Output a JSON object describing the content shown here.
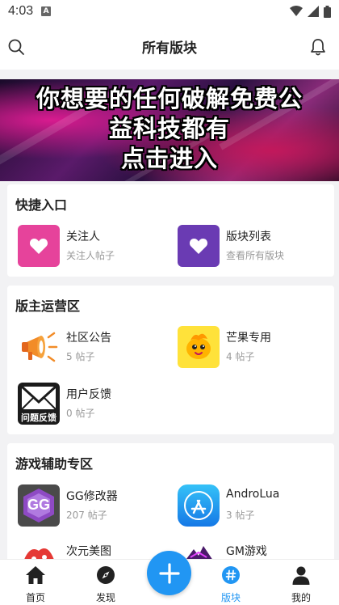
{
  "status_bar": {
    "time": "4:03",
    "sim_label": "A"
  },
  "header": {
    "title": "所有版块"
  },
  "banner": {
    "lines": [
      "你想要的任何破解免费公",
      "益科技都有",
      "点击进入"
    ]
  },
  "sections": [
    {
      "title": "快捷入口",
      "items": [
        {
          "name": "关注人",
          "sub": "关注人帖子",
          "icon": "heart-icon",
          "color": "#e6439b"
        },
        {
          "name": "版块列表",
          "sub": "查看所有版块",
          "icon": "heart-icon",
          "color": "#6a3bb3"
        }
      ]
    },
    {
      "title": "版主运营区",
      "items": [
        {
          "name": "社区公告",
          "sub": "5 帖子",
          "icon": "megaphone-icon"
        },
        {
          "name": "芒果专用",
          "sub": "4 帖子",
          "icon": "mango-mascot-icon"
        },
        {
          "name": "用户反馈",
          "sub": "0 帖子",
          "icon": "feedback-envelope-icon",
          "badge": "问题反馈"
        }
      ]
    },
    {
      "title": "游戏辅助专区",
      "items": [
        {
          "name": "GG修改器",
          "sub": "207 帖子",
          "icon": "gg-modifier-icon",
          "badge": "GG"
        },
        {
          "name": "AndroLua",
          "sub": "3 帖子",
          "icon": "app-store-icon"
        },
        {
          "name": "次元美图",
          "sub": "",
          "icon": "anime-art-icon"
        },
        {
          "name": "GM游戏",
          "sub": "",
          "icon": "gm-game-icon"
        }
      ]
    }
  ],
  "bottom_nav": [
    {
      "label": "首页",
      "icon": "home-icon"
    },
    {
      "label": "发现",
      "icon": "compass-icon"
    },
    {
      "label": "版块",
      "icon": "hashtag-icon",
      "active": true
    },
    {
      "label": "我的",
      "icon": "person-icon"
    }
  ],
  "colors": {
    "accent": "#2196f3",
    "background": "#f2f2f4"
  }
}
